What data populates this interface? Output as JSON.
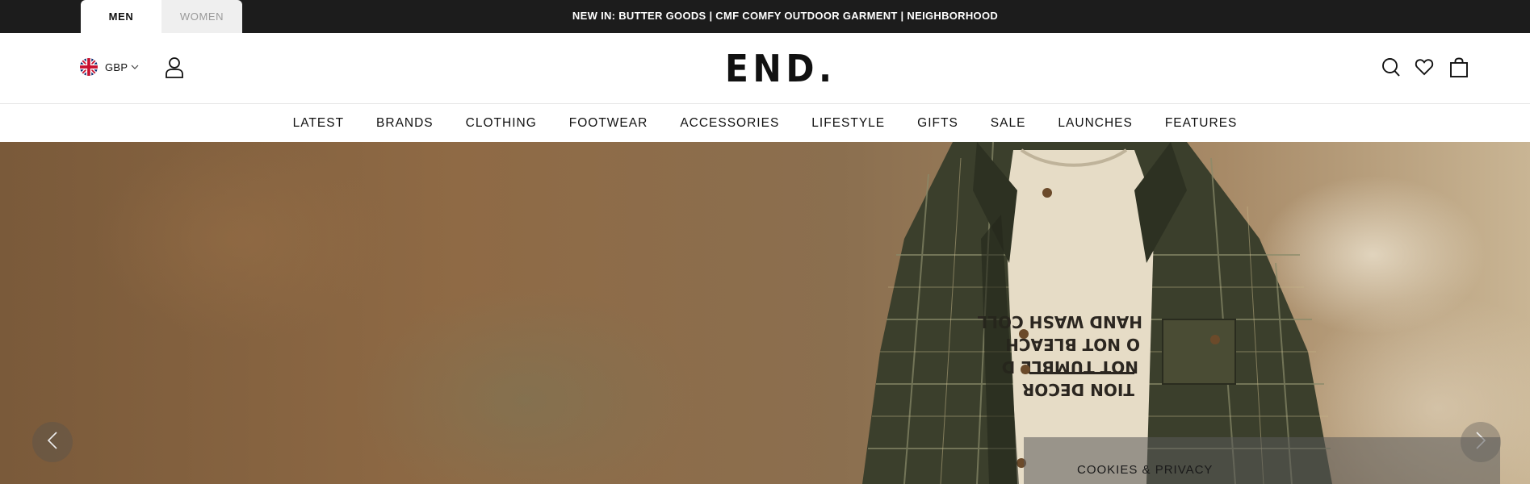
{
  "gender_tabs": [
    {
      "label": "MEN",
      "active": true
    },
    {
      "label": "WOMEN",
      "active": false
    }
  ],
  "announcement": "NEW IN: BUTTER GOODS | CMF COMFY OUTDOOR GARMENT | NEIGHBORHOOD",
  "header": {
    "currency": "GBP",
    "currency_flag_icon": "uk-flag-icon",
    "logo": "END.",
    "icons": [
      "account-icon",
      "search-icon",
      "wishlist-heart-icon",
      "shopping-bag-icon"
    ]
  },
  "nav": {
    "items": [
      "LATEST",
      "BRANDS",
      "CLOTHING",
      "FOOTWEAR",
      "ACCESSORIES",
      "LIFESTYLE",
      "GIFTS",
      "SALE",
      "LAUNCHES",
      "FEATURES"
    ]
  },
  "hero": {
    "prev_icon": "chevron-left-icon",
    "next_icon": "chevron-right-icon"
  },
  "cookie_banner": {
    "label": "COOKIES & PRIVACY"
  },
  "colors": {
    "topbar": "#1c1c1c",
    "text": "#111111",
    "inactive_tab": "#efefef"
  }
}
